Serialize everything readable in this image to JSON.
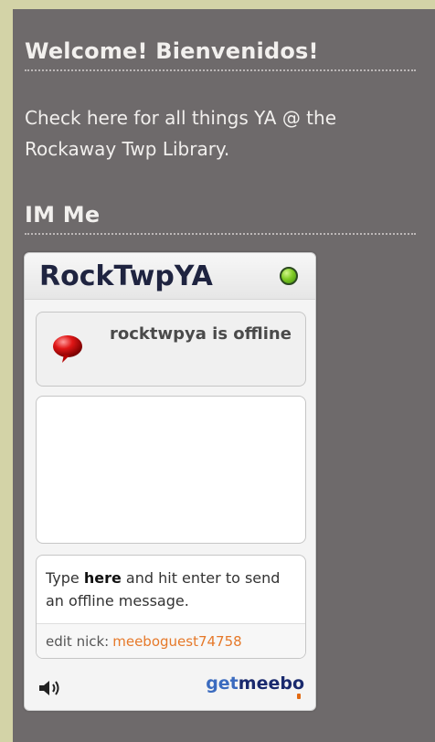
{
  "sidebar": {
    "welcome_heading": "Welcome! Bienvenidos!",
    "intro_text": "Check here for all things YA @ the Rockaway Twp Library.",
    "im_heading": "IM Me"
  },
  "meebo_widget": {
    "title": "RockTwpYA",
    "status_icon": "online-status-dot-icon",
    "status_text": "rocktwpya is offline",
    "prompt_pre": "Type ",
    "prompt_bold": "here",
    "prompt_post": " and hit enter to send an offline message.",
    "edit_nick_label": "edit nick:",
    "nick_value": "meeboguest74758",
    "sound_icon": "speaker-icon",
    "brand_get": "get",
    "brand_meeb": "meeb",
    "brand_o": "o"
  },
  "colors": {
    "page_background": "#d3d3a7",
    "panel_background": "#6e6a6b",
    "nick_color": "#e6792a",
    "brand_blue": "#1a2a6e"
  }
}
